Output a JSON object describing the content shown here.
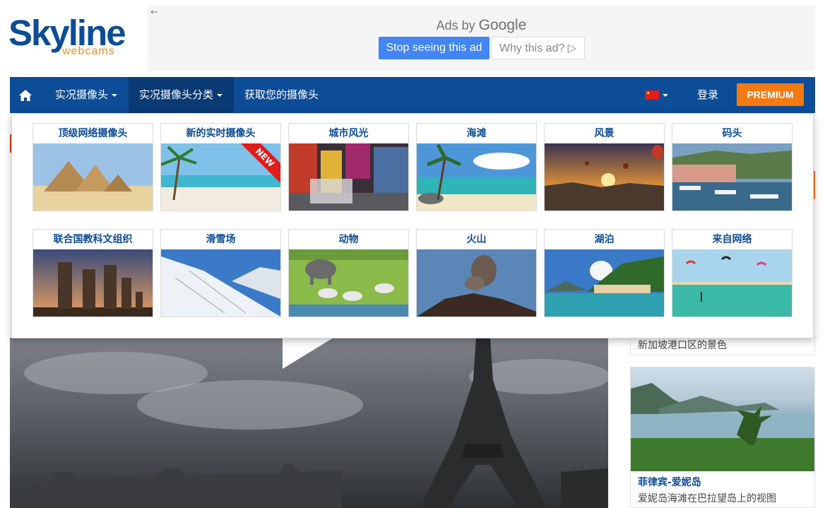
{
  "logo": {
    "main": "Skyline",
    "sub": "webcams"
  },
  "ad": {
    "back_arrow": "←",
    "label_prefix": "Ads by",
    "label_brand": "Google",
    "stop_button": "Stop seeing this ad",
    "why_button": "Why this ad? ▷"
  },
  "nav": {
    "home_icon": "home-icon",
    "live_cams": "实况摄像头",
    "live_categories": "实况摄像头分类",
    "get_your_cam": "获取您的摄像头",
    "flag": "china-flag",
    "login": "登录",
    "premium": "PREMIUM"
  },
  "menu": {
    "tiles": [
      {
        "label": "顶级网络摄像头",
        "image": "pyramids"
      },
      {
        "label": "新的实时摄像头",
        "image": "beach-palm",
        "badge": "NEW"
      },
      {
        "label": "城市风光",
        "image": "city-street"
      },
      {
        "label": "海滩",
        "image": "tropical-beach"
      },
      {
        "label": "风景",
        "image": "balloons-sunset"
      },
      {
        "label": "码头",
        "image": "harbor"
      },
      {
        "label": "联合国教科文组织",
        "image": "moai"
      },
      {
        "label": "滑雪场",
        "image": "ski-slope"
      },
      {
        "label": "动物",
        "image": "safari"
      },
      {
        "label": "火山",
        "image": "volcano"
      },
      {
        "label": "湖泊",
        "image": "lake-village"
      },
      {
        "label": "来自网络",
        "image": "kite-beach"
      }
    ]
  },
  "sidebar": {
    "card1_text": "新加坡港口区的景色",
    "card2_title": "菲律宾-爱妮岛",
    "card2_text": "爱妮岛海滩在巴拉望岛上的视图"
  },
  "colors": {
    "brand_blue": "#0d4c96",
    "accent_orange": "#f47a11",
    "ad_blue": "#4285f4"
  }
}
